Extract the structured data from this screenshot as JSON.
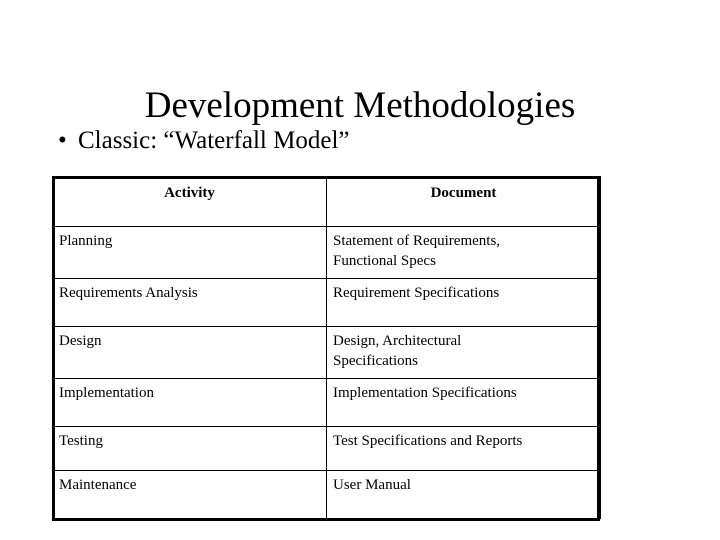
{
  "slide": {
    "title": "Development Methodologies",
    "bullet": {
      "glyph": "•",
      "text": "Classic:  “Waterfall Model”"
    },
    "table": {
      "headers": [
        "Activity",
        "Document"
      ],
      "rows": [
        {
          "activity": "Planning",
          "document_lines": [
            "Statement of Requirements,",
            "Functional Specs"
          ]
        },
        {
          "activity": "Requirements Analysis",
          "document_lines": [
            "Requirement Specifications"
          ]
        },
        {
          "activity": "Design",
          "document_lines": [
            "Design, Architectural",
            "Specifications"
          ]
        },
        {
          "activity": "Implementation",
          "document_lines": [
            "Implementation Specifications"
          ]
        },
        {
          "activity": "Testing",
          "document_lines": [
            "Test Specifications and Reports"
          ]
        },
        {
          "activity": "Maintenance",
          "document_lines": [
            "User Manual"
          ]
        }
      ]
    },
    "colors": {
      "background": "#ffffff",
      "text": "#000000",
      "border": "#000000"
    }
  }
}
